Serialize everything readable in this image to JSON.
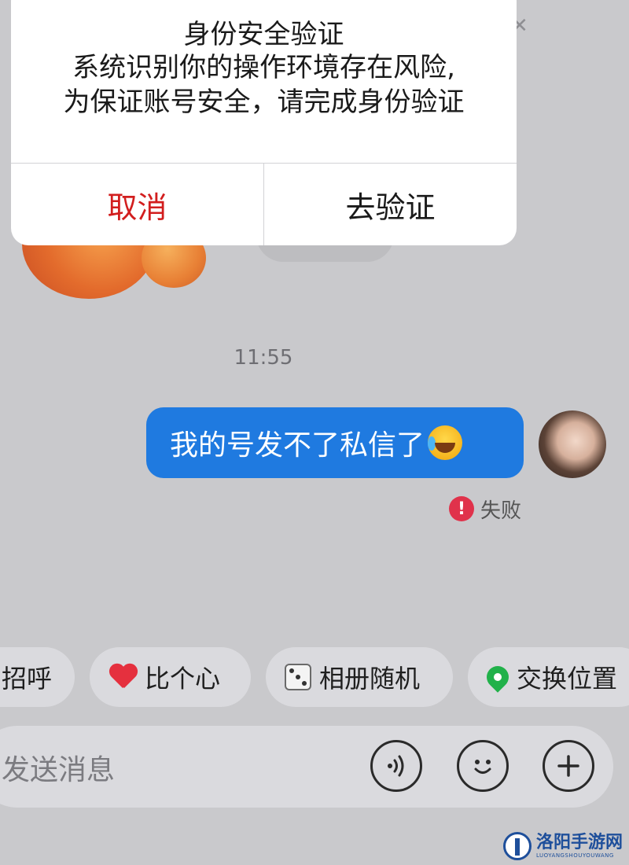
{
  "dialog": {
    "title": "身份安全验证",
    "message_line1": "系统识别你的操作环境存在风险,",
    "message_line2": "为保证账号安全，请完成身份验证",
    "cancel_label": "取消",
    "confirm_label": "去验证"
  },
  "chat": {
    "timestamp": "11:55",
    "message_text": "我的号发不了私信了",
    "status_text": "失败"
  },
  "quick_actions": {
    "greet": "招呼",
    "heart": "比个心",
    "dice": "相册随机",
    "location": "交换位置"
  },
  "input": {
    "placeholder": "发送消息"
  },
  "watermark": {
    "title": "洛阳手游网",
    "subtitle": "LUOYANGSHOUYOUWANG"
  },
  "colors": {
    "bubble": "#1f7ae0",
    "cancel": "#d21e1e",
    "fail": "#e0324b"
  },
  "icons": [
    "fail-icon",
    "heart-icon",
    "dice-icon",
    "location-pin-icon",
    "voice-icon",
    "emoji-icon",
    "plus-icon",
    "laugh-emoji"
  ]
}
